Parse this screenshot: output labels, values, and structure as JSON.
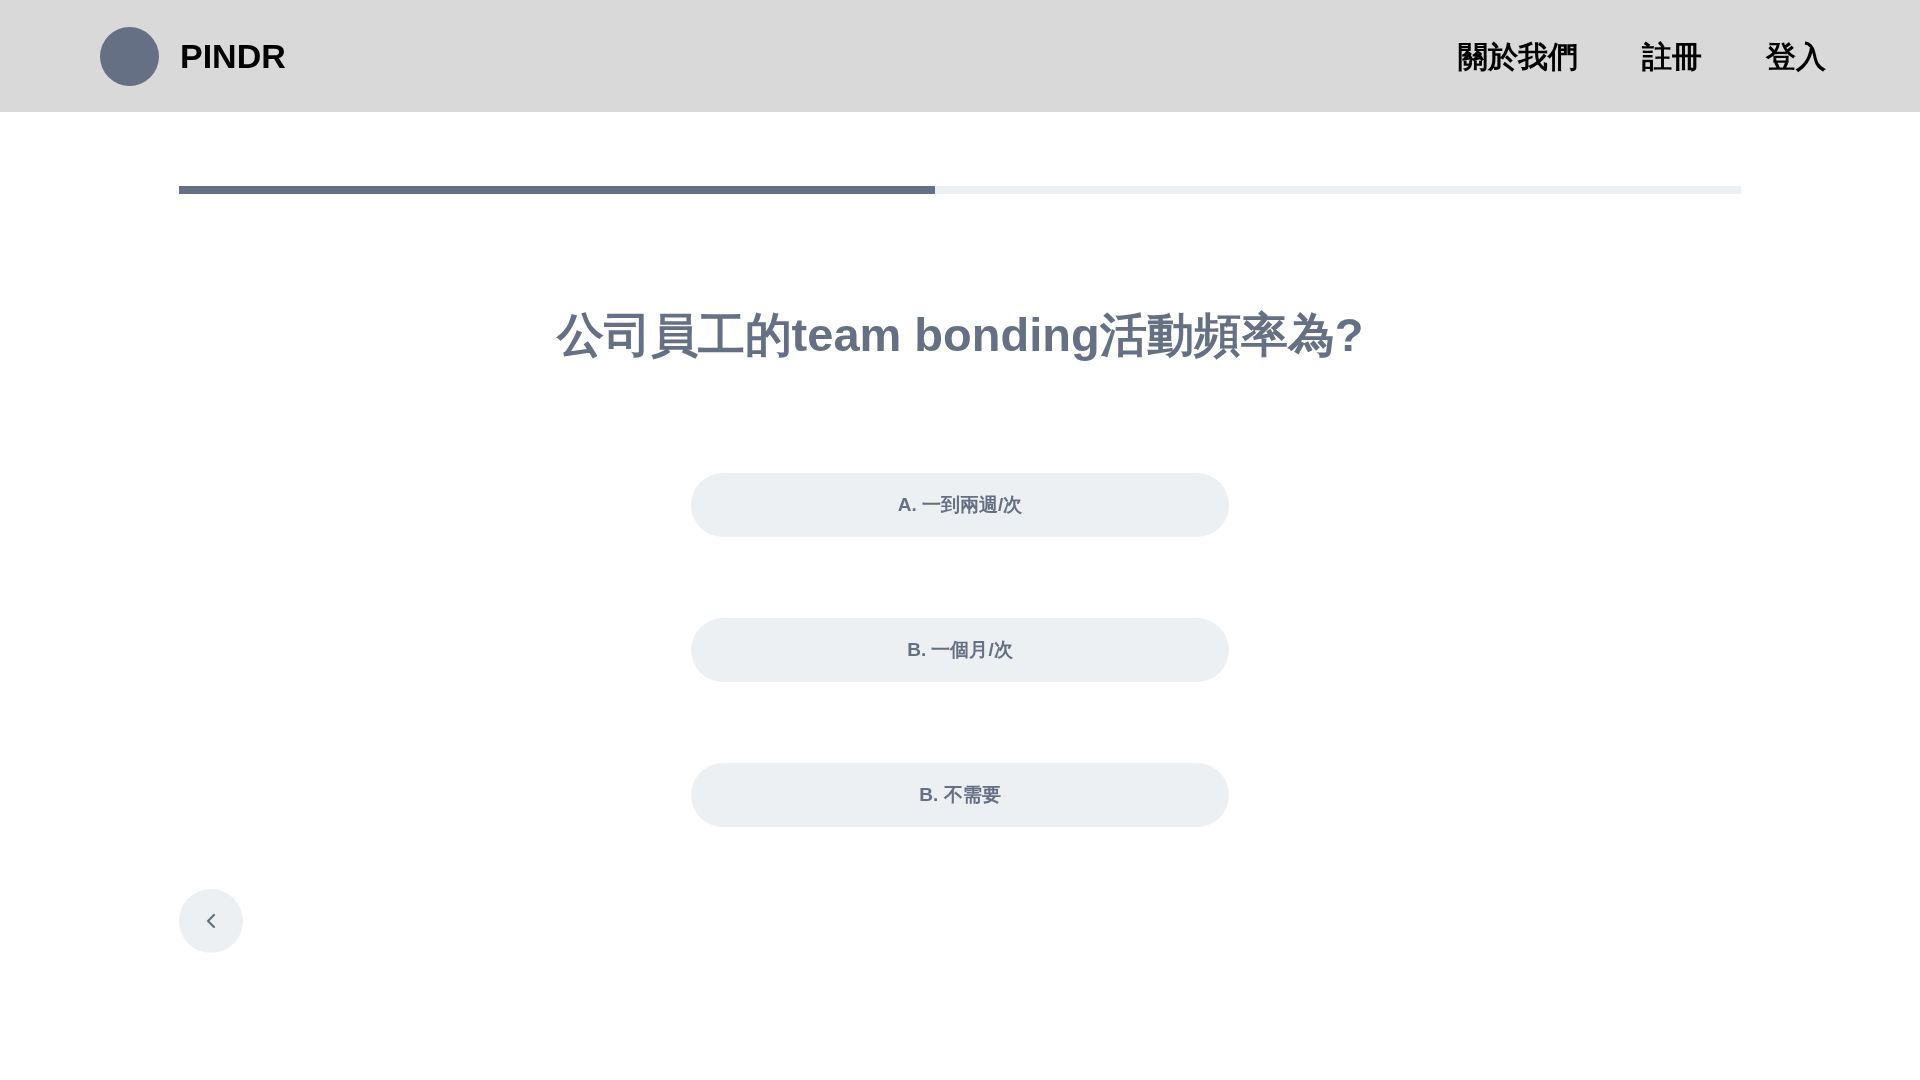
{
  "header": {
    "brand": "PINDR",
    "nav": [
      "關於我們",
      "註冊",
      "登入"
    ]
  },
  "progress": {
    "level": 0.484
  },
  "question": {
    "title": "公司員工的team bonding活動頻率為?"
  },
  "options": [
    {
      "label": "A. 一到兩週/次",
      "selected": false
    },
    {
      "label": "B. 一個月/次",
      "selected": false
    },
    {
      "label": "B. 不需要",
      "selected": false
    }
  ]
}
